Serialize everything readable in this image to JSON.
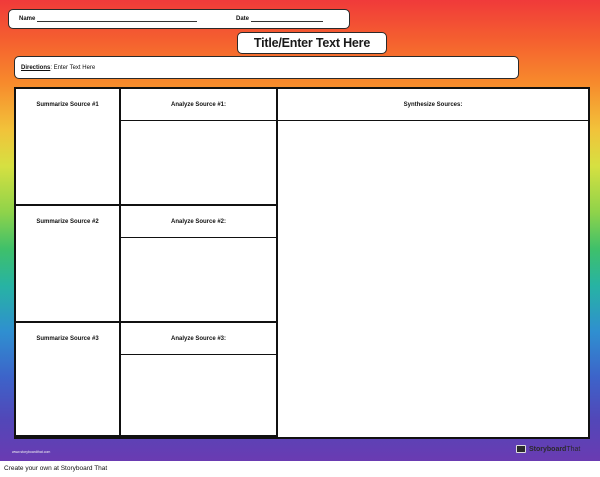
{
  "header": {
    "name_label": "Name",
    "date_label": "Date"
  },
  "title": "Title/Enter Text Here",
  "directions": {
    "label": "Directions",
    "text": ": Enter Text Here"
  },
  "grid": {
    "summarize": [
      "Summarize Source #1",
      "Summarize Source #2",
      "Summarize Source #3"
    ],
    "analyze": [
      "Analyze Source #1:",
      "Analyze Source #2:",
      "Analyze Source #3:"
    ],
    "synthesize": "Synthesize Sources:"
  },
  "footer": {
    "url": "www.storyboardthat.com",
    "logo_bold": "Storyboard",
    "logo_light": "That"
  },
  "caption": "Create your own at Storyboard That"
}
